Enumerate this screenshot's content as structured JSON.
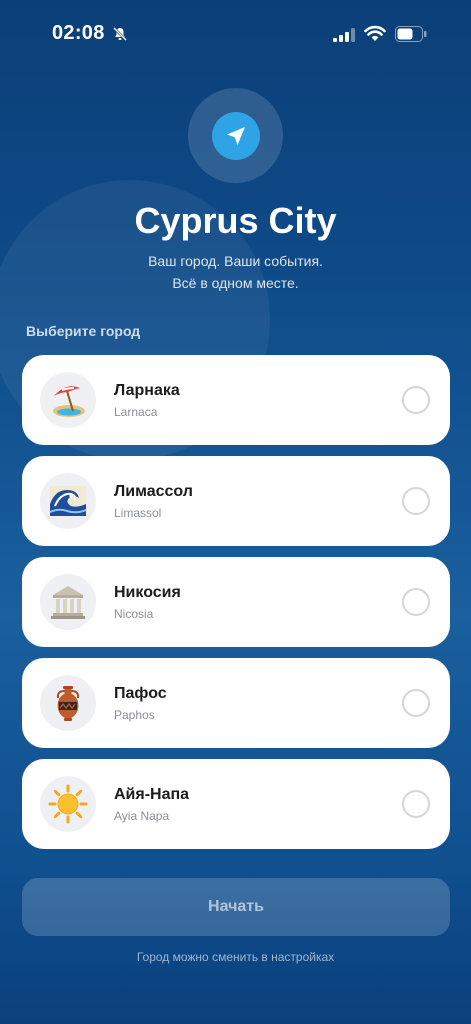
{
  "status_bar": {
    "time": "02:08",
    "icons": [
      "bell-slash-icon",
      "cellular-signal-icon",
      "wifi-icon",
      "battery-icon"
    ]
  },
  "header": {
    "logo_icon": "location-arrow-icon",
    "title": "Cyprus City",
    "subtitle_line1": "Ваш город. Ваши события.",
    "subtitle_line2": "Всё в одном месте."
  },
  "city_section": {
    "label": "Выберите город",
    "cities": [
      {
        "name": "Ларнака",
        "latin": "Larnaca",
        "icon": "beach-umbrella-icon",
        "selected": false
      },
      {
        "name": "Лимассол",
        "latin": "Limassol",
        "icon": "wave-icon",
        "selected": false
      },
      {
        "name": "Никосия",
        "latin": "Nicosia",
        "icon": "classical-building-icon",
        "selected": false
      },
      {
        "name": "Пафос",
        "latin": "Paphos",
        "icon": "amphora-icon",
        "selected": false
      },
      {
        "name": "Айя-Напа",
        "latin": "Ayia Napa",
        "icon": "sun-icon",
        "selected": false
      }
    ]
  },
  "start_button": {
    "label": "Начать",
    "enabled": false
  },
  "footer": {
    "note": "Город можно сменить в настройках"
  },
  "colors": {
    "accent": "#2ea4e6",
    "background_top": "#0b3f78",
    "card": "#ffffff"
  }
}
